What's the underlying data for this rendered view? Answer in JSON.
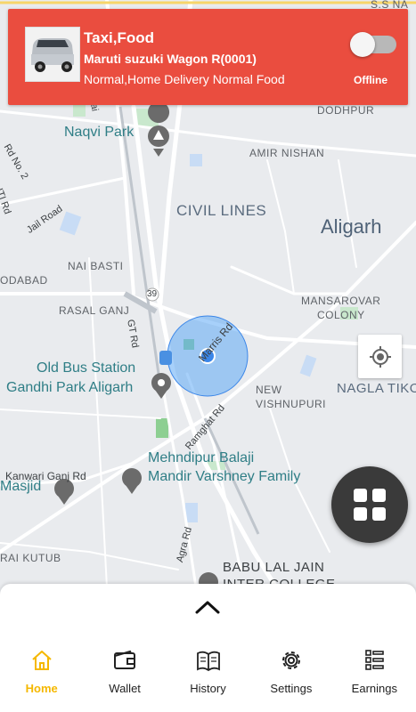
{
  "banner": {
    "title": "Taxi,Food",
    "vehicle": "Maruti suzuki Wagon R(0001)",
    "services": "Normal,Home Delivery Normal Food",
    "status_label": "Offline",
    "toggle_on": false,
    "accent_color": "#ea4d3f"
  },
  "map": {
    "labels": {
      "ssna": "S.S NA",
      "dodhpur": "DODHPUR",
      "naqvi_park": "Naqvi Park",
      "amir_nishan": "AMIR NISHAN",
      "rd_no2": "Rd No. 2",
      "iti_rd": "ITI Rd",
      "jail_road": "Jail Road",
      "civil_lines": "CIVIL LINES",
      "aligarh": "Aligarh",
      "nai_basti": "NAI BASTI",
      "dodabad": "ODABAD",
      "rasal_ganj": "RASAL GANJ",
      "mansarovar": "MANSAROVAR",
      "colony": "COLONY",
      "gt_rd": "GT Rd",
      "road39": "39",
      "marris_rd": "Marris Rd",
      "old_bus_station": "Old Bus Station",
      "gandhi_park": "Gandhi Park Aligarh",
      "new": "NEW",
      "vishnupuri": "VISHNUPURI",
      "nagla_tiko": "NAGLA TIKO",
      "ramghat_rd": "Ramghat Rd",
      "mehndipur1": "Mehndipur Balaji",
      "mehndipur2": "Mandir Varshney Family",
      "kanwari": "Kanwari Ganj Rd",
      "masjid": "Masjid",
      "rai_kutub": "RAI KUTUB",
      "agra_rd": "Agra Rd",
      "babu_lal1": "BABU LAL JAIN",
      "babu_lal2": "INTER COLLEGE",
      "jail": "Jai"
    }
  },
  "nav": {
    "items": [
      {
        "label": "Home",
        "icon": "home-icon"
      },
      {
        "label": "Wallet",
        "icon": "wallet-icon"
      },
      {
        "label": "History",
        "icon": "book-icon"
      },
      {
        "label": "Settings",
        "icon": "gear-icon"
      },
      {
        "label": "Earnings",
        "icon": "earnings-list-icon"
      }
    ],
    "active": "Home",
    "active_color": "#f5b800"
  }
}
